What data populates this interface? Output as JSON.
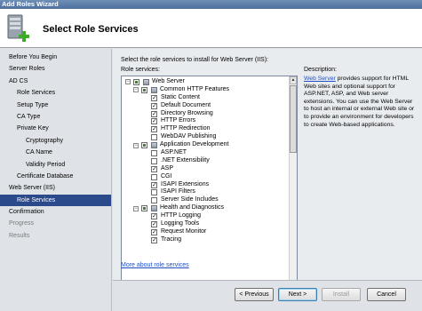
{
  "window": {
    "title": "Add Roles Wizard"
  },
  "header": {
    "title": "Select Role Services"
  },
  "nav": {
    "items": [
      {
        "label": "Before You Begin",
        "level": 0,
        "state": "normal"
      },
      {
        "label": "Server Roles",
        "level": 0,
        "state": "normal"
      },
      {
        "label": "AD CS",
        "level": 0,
        "state": "normal"
      },
      {
        "label": "Role Services",
        "level": 1,
        "state": "normal"
      },
      {
        "label": "Setup Type",
        "level": 1,
        "state": "normal"
      },
      {
        "label": "CA Type",
        "level": 1,
        "state": "normal"
      },
      {
        "label": "Private Key",
        "level": 1,
        "state": "normal"
      },
      {
        "label": "Cryptography",
        "level": 2,
        "state": "normal"
      },
      {
        "label": "CA Name",
        "level": 2,
        "state": "normal"
      },
      {
        "label": "Validity Period",
        "level": 2,
        "state": "normal"
      },
      {
        "label": "Certificate Database",
        "level": 1,
        "state": "normal"
      },
      {
        "label": "Web Server (IIS)",
        "level": 0,
        "state": "normal"
      },
      {
        "label": "Role Services",
        "level": 1,
        "state": "selected"
      },
      {
        "label": "Confirmation",
        "level": 0,
        "state": "normal"
      },
      {
        "label": "Progress",
        "level": 0,
        "state": "disabled"
      },
      {
        "label": "Results",
        "level": 0,
        "state": "disabled"
      }
    ]
  },
  "main": {
    "instruction": "Select the role services to install for Web Server (IIS):",
    "tree_label": "Role services:",
    "description_title": "Description:",
    "description_link": "Web Server",
    "description_text": " provides support for HTML Web sites and optional support for ASP.NET, ASP, and Web server extensions. You can use the Web Server to host an internal or external Web site or to provide an environment for developers to create Web-based applications.",
    "more_link": "More about role services",
    "tree": [
      {
        "label": "Web Server",
        "depth": 0,
        "expander": "−",
        "check": "partial",
        "icon": true
      },
      {
        "label": "Common HTTP Features",
        "depth": 1,
        "expander": "−",
        "check": "partial",
        "icon": true
      },
      {
        "label": "Static Content",
        "depth": 2,
        "expander": "",
        "check": "checked",
        "icon": false
      },
      {
        "label": "Default Document",
        "depth": 2,
        "expander": "",
        "check": "checked",
        "icon": false
      },
      {
        "label": "Directory Browsing",
        "depth": 2,
        "expander": "",
        "check": "checked",
        "icon": false
      },
      {
        "label": "HTTP Errors",
        "depth": 2,
        "expander": "",
        "check": "checked",
        "icon": false
      },
      {
        "label": "HTTP Redirection",
        "depth": 2,
        "expander": "",
        "check": "checked",
        "icon": false
      },
      {
        "label": "WebDAV Publishing",
        "depth": 2,
        "expander": "",
        "check": "unchecked",
        "icon": false
      },
      {
        "label": "Application Development",
        "depth": 1,
        "expander": "−",
        "check": "partial",
        "icon": true
      },
      {
        "label": "ASP.NET",
        "depth": 2,
        "expander": "",
        "check": "unchecked",
        "icon": false
      },
      {
        "label": ".NET Extensibility",
        "depth": 2,
        "expander": "",
        "check": "unchecked",
        "icon": false
      },
      {
        "label": "ASP",
        "depth": 2,
        "expander": "",
        "check": "checked",
        "icon": false
      },
      {
        "label": "CGI",
        "depth": 2,
        "expander": "",
        "check": "unchecked",
        "icon": false
      },
      {
        "label": "ISAPI Extensions",
        "depth": 2,
        "expander": "",
        "check": "checked",
        "icon": false
      },
      {
        "label": "ISAPI Filters",
        "depth": 2,
        "expander": "",
        "check": "unchecked",
        "icon": false
      },
      {
        "label": "Server Side Includes",
        "depth": 2,
        "expander": "",
        "check": "unchecked",
        "icon": false
      },
      {
        "label": "Health and Diagnostics",
        "depth": 1,
        "expander": "−",
        "check": "partial",
        "icon": true
      },
      {
        "label": "HTTP Logging",
        "depth": 2,
        "expander": "",
        "check": "checked",
        "icon": false
      },
      {
        "label": "Logging Tools",
        "depth": 2,
        "expander": "",
        "check": "checked",
        "icon": false
      },
      {
        "label": "Request Monitor",
        "depth": 2,
        "expander": "",
        "check": "checked",
        "icon": false
      },
      {
        "label": "Tracing",
        "depth": 2,
        "expander": "",
        "check": "checked",
        "icon": false
      }
    ]
  },
  "buttons": {
    "previous": "< Previous",
    "next": "Next >",
    "install": "Install",
    "cancel": "Cancel"
  },
  "colors": {
    "selection": "#2a4a8b",
    "link": "#1f4fc2"
  }
}
